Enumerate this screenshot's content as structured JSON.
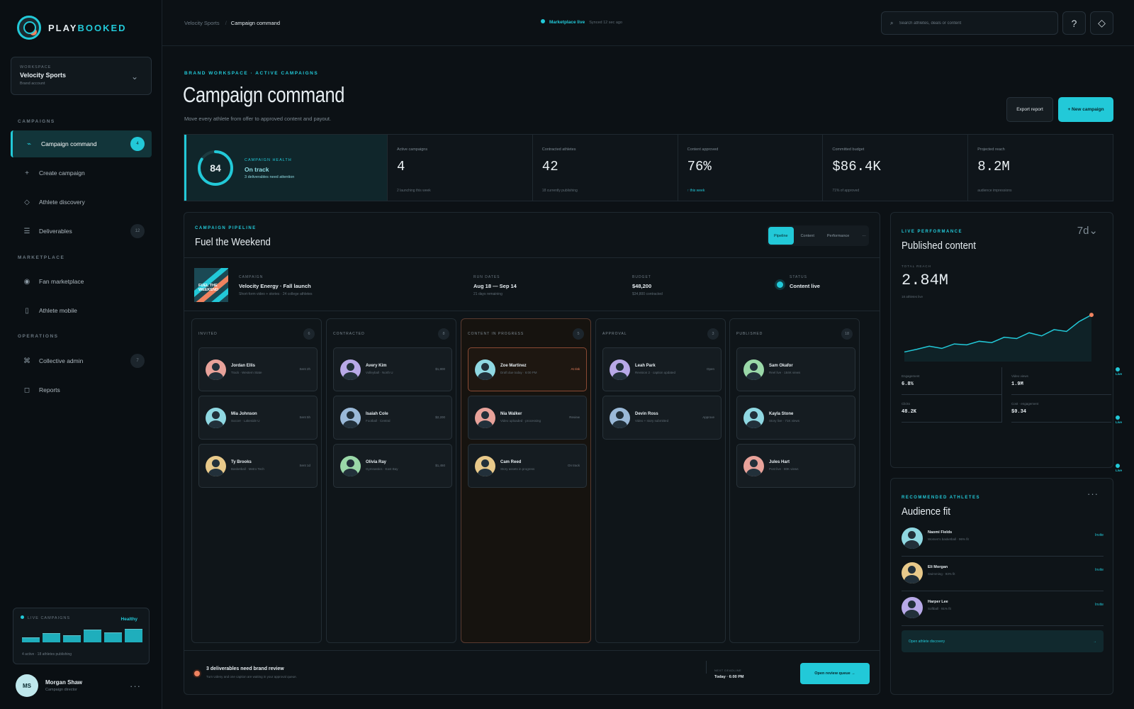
{
  "brand": {
    "play": "PLAY",
    "booked": "BOOKED"
  },
  "workspace": {
    "label": "WORKSPACE",
    "name": "Velocity Sports",
    "sub": "Brand account"
  },
  "sections": {
    "campaigns": "CAMPAIGNS",
    "marketplace": "MARKETPLACE",
    "operations": "OPERATIONS"
  },
  "nav": [
    {
      "label": "Campaign command",
      "icon": "pulse-icon",
      "count": "4"
    },
    {
      "label": "Create campaign",
      "icon": "plus-icon",
      "count": ""
    },
    {
      "label": "Athlete discovery",
      "icon": "diamond-icon",
      "count": ""
    },
    {
      "label": "Deliverables",
      "icon": "list-icon",
      "count": "12"
    },
    {
      "label": "Fan marketplace",
      "icon": "circle-icon",
      "count": ""
    },
    {
      "label": "Athlete mobile",
      "icon": "phone-icon",
      "count": ""
    },
    {
      "label": "Collective admin",
      "icon": "command-icon",
      "count": "7"
    },
    {
      "label": "Reports",
      "icon": "square-icon",
      "count": ""
    }
  ],
  "live_campaigns": {
    "label": "LIVE CAMPAIGNS",
    "status": "Healthy",
    "bars": [
      0.35,
      0.65,
      0.5,
      0.9,
      0.7,
      0.95
    ],
    "footer": "4 active · 18 athletes publishing"
  },
  "user": {
    "initials": "MS",
    "name": "Morgan Shaw",
    "role": "Campaign director"
  },
  "breadcrumb": {
    "root": "Velocity Sports",
    "current": "Campaign command"
  },
  "live_status": {
    "label": "Marketplace live",
    "sync": "Synced 12 sec ago"
  },
  "search": {
    "placeholder": "Search athletes, deals or content"
  },
  "header": {
    "eyebrow": "BRAND WORKSPACE · ACTIVE CAMPAIGNS",
    "title": "Campaign command",
    "subtitle": "Move every athlete from offer to approved content and payout.",
    "export": "Export report",
    "new": "+ New campaign"
  },
  "health": {
    "score": "84",
    "score_fraction": 0.84,
    "label": "CAMPAIGN HEALTH",
    "status": "On track",
    "note": "3 deliverables need attention"
  },
  "stats": [
    {
      "label": "Active campaigns",
      "value": "4",
      "note": "2 launching this week",
      "accent": false
    },
    {
      "label": "Contracted athletes",
      "value": "42",
      "note": "18 currently publishing",
      "accent": false
    },
    {
      "label": "Content approved",
      "value": "76%",
      "note": "↑ this week",
      "accent": true
    },
    {
      "label": "Committed budget",
      "value": "$86.4K",
      "note": "71% of approved",
      "accent": false
    },
    {
      "label": "Projected reach",
      "value": "8.2M",
      "note": "audience impressions",
      "accent": false
    }
  ],
  "pipeline": {
    "eyebrow": "CAMPAIGN PIPELINE",
    "title": "Fuel the Weekend",
    "tabs": [
      "Pipeline",
      "Content",
      "Performance",
      "···"
    ],
    "cover_text": "FUEL THE WEEKEND",
    "campaign": {
      "label": "CAMPAIGN",
      "value": "Velocity Energy · Fall launch",
      "sub": "Short-form video + stories · 24 college athletes"
    },
    "dates": {
      "label": "RUN DATES",
      "value": "Aug 18 — Sep 14",
      "sub": "21 days remaining"
    },
    "budget": {
      "label": "BUDGET",
      "value": "$48,200",
      "sub": "$34,800 contracted"
    },
    "status": {
      "label": "STATUS",
      "value": "Content live"
    },
    "columns": [
      {
        "title": "INVITED",
        "count": "6",
        "cards": [
          {
            "name": "Jordan Ellis",
            "sub": "Track · Western State",
            "tag": "Sent 2h",
            "color": "#e8a29a",
            "tone": ""
          },
          {
            "name": "Mia Johnson",
            "sub": "Soccer · Lakeside U",
            "tag": "Sent 5h",
            "color": "#8fd8e2",
            "tone": ""
          },
          {
            "name": "Ty Brooks",
            "sub": "Basketball · Metro Tech",
            "tag": "Sent 1d",
            "color": "#e8c98a",
            "tone": ""
          }
        ]
      },
      {
        "title": "CONTRACTED",
        "count": "8",
        "cards": [
          {
            "name": "Avery Kim",
            "sub": "Volleyball · North U",
            "tag": "$1,800",
            "color": "#b8a9e8",
            "tone": ""
          },
          {
            "name": "Isaiah Cole",
            "sub": "Football · Central",
            "tag": "$2,200",
            "color": "#9ab9d8",
            "tone": ""
          },
          {
            "name": "Olivia Ray",
            "sub": "Gymnastics · East Bay",
            "tag": "$1,450",
            "color": "#9ad8a8",
            "tone": ""
          }
        ]
      },
      {
        "title": "CONTENT IN PROGRESS",
        "count": "5",
        "cards": [
          {
            "name": "Zoe Martinez",
            "sub": "Draft due today · 6:00 PM",
            "tag": "At risk",
            "color": "#8fd8e2",
            "tone": "risk"
          },
          {
            "name": "Nia Walker",
            "sub": "Video uploaded · processing",
            "tag": "Review",
            "color": "#e8a29a",
            "tone": ""
          },
          {
            "name": "Cam Reed",
            "sub": "Story assets in progress",
            "tag": "On track",
            "color": "#e8c98a",
            "tone": ""
          }
        ]
      },
      {
        "title": "APPROVAL",
        "count": "3",
        "cards": [
          {
            "name": "Leah Park",
            "sub": "Revision 2 · caption updated",
            "tag": "Open",
            "color": "#b8a9e8",
            "tone": ""
          },
          {
            "name": "Devin Ross",
            "sub": "Video + story submitted",
            "tag": "Approve",
            "color": "#9ab9d8",
            "tone": ""
          }
        ]
      },
      {
        "title": "PUBLISHED",
        "count": "18",
        "cards": [
          {
            "name": "Sam Okafor",
            "sub": "Reel live · 184K views",
            "tag": "Live",
            "color": "#9ad8a8",
            "tone": "live"
          },
          {
            "name": "Kayla Stone",
            "sub": "Story live · 71K views",
            "tag": "Live",
            "color": "#8fd8e2",
            "tone": "live"
          },
          {
            "name": "Jules Hart",
            "sub": "Post live · 80K views",
            "tag": "Live",
            "color": "#e8a29a",
            "tone": "live"
          }
        ]
      }
    ],
    "footer": {
      "title": "3 deliverables need brand review",
      "sub": "Turn Udeny and one caption are waiting in your approval queue.",
      "next_label": "NEXT DEADLINE",
      "next_value": "Today · 6:00 PM",
      "button": "Open review queue →"
    }
  },
  "performance": {
    "eyebrow": "LIVE PERFORMANCE",
    "title": "Published content",
    "range": "7d⌄",
    "reach_label": "TOTAL REACH",
    "reach_value": "2.84M",
    "reach_note": "18 athletes live",
    "series": [
      0.12,
      0.18,
      0.25,
      0.2,
      0.3,
      0.28,
      0.36,
      0.33,
      0.45,
      0.42,
      0.55,
      0.48,
      0.62,
      0.58,
      0.8,
      0.95
    ],
    "stats": [
      {
        "label": "Engagement",
        "value": "6.8%"
      },
      {
        "label": "Video views",
        "value": "1.9M"
      },
      {
        "label": "Clicks",
        "value": "48.2K"
      },
      {
        "label": "Cost · engagement",
        "value": "$0.34"
      }
    ]
  },
  "recommended": {
    "eyebrow": "RECOMMENDED ATHLETES",
    "title": "Audience fit",
    "more": "···",
    "athletes": [
      {
        "name": "Naomi Fields",
        "sub": "Women's basketball · 96% fit",
        "action": "Invite",
        "color": "#8fd8e2"
      },
      {
        "name": "Eli Morgan",
        "sub": "Swimming · 93% fit",
        "action": "Invite",
        "color": "#e8c98a"
      },
      {
        "name": "Harper Lee",
        "sub": "Softball · 91% fit",
        "action": "Invite",
        "color": "#b8a9e8"
      }
    ],
    "cta": "Open athlete discovery",
    "cta_arrow": "→"
  },
  "colors": {
    "accent": "#22c9d8",
    "warn": "#ef8360",
    "bg": "#0c1115"
  }
}
